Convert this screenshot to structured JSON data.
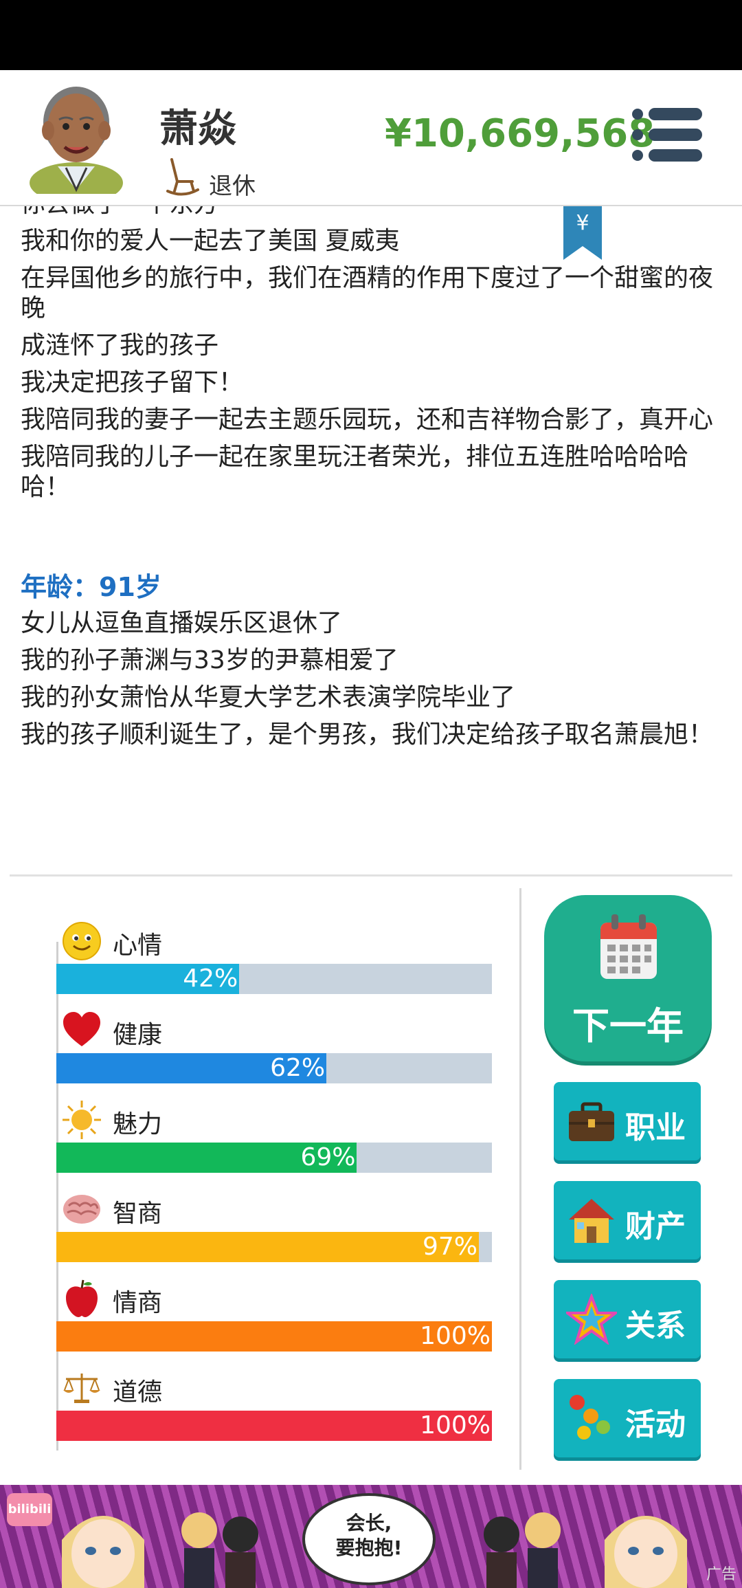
{
  "header": {
    "name": "萧焱",
    "status": "退休",
    "money": "¥10,669,568"
  },
  "log": {
    "partial_top": "你去做了一个东方",
    "entries": [
      "我和你的爱人一起去了美国 夏威夷",
      "在异国他乡的旅行中，我们在酒精的作用下度过了一个甜蜜的夜晚",
      "成涟怀了我的孩子",
      "我决定把孩子留下！",
      "我陪同我的妻子一起去主题乐园玩，还和吉祥物合影了，真开心",
      "我陪同我的儿子一起在家里玩汪者荣光，排位五连胜哈哈哈哈哈！"
    ],
    "age_label": "年龄：91岁",
    "entries_age": [
      "女儿从逗鱼直播娱乐区退休了",
      "我的孙子萧渊与33岁的尹慕相爱了",
      "我的孙女萧怡从华夏大学艺术表演学院毕业了",
      "我的孩子顺利诞生了，是个男孩，我们决定给孩子取名萧晨旭！"
    ]
  },
  "stats": [
    {
      "label": "心情",
      "value": 42,
      "pct": "42%",
      "color": "#1ab1dc",
      "icon": "smiley-face-icon"
    },
    {
      "label": "健康",
      "value": 62,
      "pct": "62%",
      "color": "#1f88e0",
      "icon": "heart-icon"
    },
    {
      "label": "魅力",
      "value": 69,
      "pct": "69%",
      "color": "#12b859",
      "icon": "sun-icon"
    },
    {
      "label": "智商",
      "value": 97,
      "pct": "97%",
      "color": "#fbb610",
      "icon": "brain-icon"
    },
    {
      "label": "情商",
      "value": 100,
      "pct": "100%",
      "color": "#fb7d10",
      "icon": "apple-icon"
    },
    {
      "label": "道德",
      "value": 100,
      "pct": "100%",
      "color": "#ef2f42",
      "icon": "scales-icon"
    }
  ],
  "actions": {
    "next_year": "下一年",
    "career": "职业",
    "property": "财产",
    "relations": "关系",
    "activities": "活动"
  },
  "ad": {
    "logo": "bilibili",
    "bubble": "会长,\n要抱抱!",
    "tag": "广告"
  }
}
